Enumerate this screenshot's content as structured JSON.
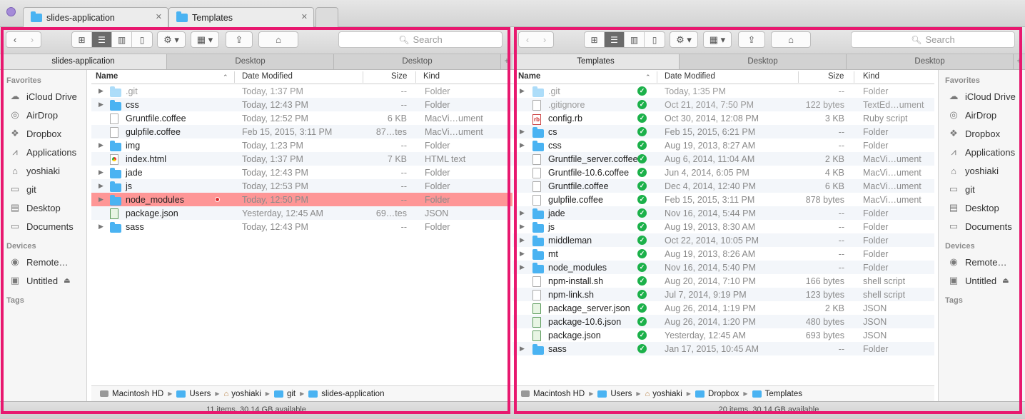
{
  "window_tabs": [
    {
      "label": "slides-application"
    },
    {
      "label": "Templates"
    }
  ],
  "left": {
    "search_placeholder": "Search",
    "pane_tabs": [
      "slides-application",
      "Desktop",
      "Desktop"
    ],
    "sidebar": {
      "favorites_header": "Favorites",
      "favorites": [
        "iCloud Drive",
        "AirDrop",
        "Dropbox",
        "Applications",
        "yoshiaki",
        "git",
        "Desktop",
        "Documents"
      ],
      "devices_header": "Devices",
      "devices": [
        "Remote…",
        "Untitled"
      ],
      "tags_header": "Tags"
    },
    "columns": {
      "name": "Name",
      "date": "Date Modified",
      "size": "Size",
      "kind": "Kind"
    },
    "rows": [
      {
        "name": ".git",
        "date": "Today, 1:37 PM",
        "size": "--",
        "kind": "Folder"
      },
      {
        "name": "css",
        "date": "Today, 12:43 PM",
        "size": "--",
        "kind": "Folder"
      },
      {
        "name": "Gruntfile.coffee",
        "date": "Today, 12:52 PM",
        "size": "6 KB",
        "kind": "MacVi…ument"
      },
      {
        "name": "gulpfile.coffee",
        "date": "Feb 15, 2015, 3:11 PM",
        "size": "87…tes",
        "kind": "MacVi…ument"
      },
      {
        "name": "img",
        "date": "Today, 1:23 PM",
        "size": "--",
        "kind": "Folder"
      },
      {
        "name": "index.html",
        "date": "Today, 1:37 PM",
        "size": "7 KB",
        "kind": "HTML text"
      },
      {
        "name": "jade",
        "date": "Today, 12:43 PM",
        "size": "--",
        "kind": "Folder"
      },
      {
        "name": "js",
        "date": "Today, 12:53 PM",
        "size": "--",
        "kind": "Folder"
      },
      {
        "name": "node_modules",
        "date": "Today, 12:50 PM",
        "size": "--",
        "kind": "Folder"
      },
      {
        "name": "package.json",
        "date": "Yesterday, 12:45 AM",
        "size": "69…tes",
        "kind": "JSON"
      },
      {
        "name": "sass",
        "date": "Today, 12:43 PM",
        "size": "--",
        "kind": "Folder"
      }
    ],
    "path": [
      "Macintosh HD",
      "Users",
      "yoshiaki",
      "git",
      "slides-application"
    ],
    "status": "11 items, 30.14 GB available"
  },
  "right": {
    "search_placeholder": "Search",
    "pane_tabs": [
      "Templates",
      "Desktop",
      "Desktop"
    ],
    "sidebar": {
      "favorites_header": "Favorites",
      "favorites": [
        "iCloud Drive",
        "AirDrop",
        "Dropbox",
        "Applications",
        "yoshiaki",
        "git",
        "Desktop",
        "Documents"
      ],
      "devices_header": "Devices",
      "devices": [
        "Remote…",
        "Untitled"
      ],
      "tags_header": "Tags"
    },
    "columns": {
      "name": "Name",
      "date": "Date Modified",
      "size": "Size",
      "kind": "Kind"
    },
    "rows": [
      {
        "name": ".git",
        "date": "Today, 1:35 PM",
        "size": "--",
        "kind": "Folder"
      },
      {
        "name": ".gitignore",
        "date": "Oct 21, 2014, 7:50 PM",
        "size": "122 bytes",
        "kind": "TextEd…ument"
      },
      {
        "name": "config.rb",
        "date": "Oct 30, 2014, 12:08 PM",
        "size": "3 KB",
        "kind": "Ruby script"
      },
      {
        "name": "cs",
        "date": "Feb 15, 2015, 6:21 PM",
        "size": "--",
        "kind": "Folder"
      },
      {
        "name": "css",
        "date": "Aug 19, 2013, 8:27 AM",
        "size": "--",
        "kind": "Folder"
      },
      {
        "name": "Gruntfile_server.coffee",
        "date": "Aug 6, 2014, 11:04 AM",
        "size": "2 KB",
        "kind": "MacVi…ument"
      },
      {
        "name": "Gruntfile-10.6.coffee",
        "date": "Jun 4, 2014, 6:05 PM",
        "size": "4 KB",
        "kind": "MacVi…ument"
      },
      {
        "name": "Gruntfile.coffee",
        "date": "Dec 4, 2014, 12:40 PM",
        "size": "6 KB",
        "kind": "MacVi…ument"
      },
      {
        "name": "gulpfile.coffee",
        "date": "Feb 15, 2015, 3:11 PM",
        "size": "878 bytes",
        "kind": "MacVi…ument"
      },
      {
        "name": "jade",
        "date": "Nov 16, 2014, 5:44 PM",
        "size": "--",
        "kind": "Folder"
      },
      {
        "name": "js",
        "date": "Aug 19, 2013, 8:30 AM",
        "size": "--",
        "kind": "Folder"
      },
      {
        "name": "middleman",
        "date": "Oct 22, 2014, 10:05 PM",
        "size": "--",
        "kind": "Folder"
      },
      {
        "name": "mt",
        "date": "Aug 19, 2013, 8:26 AM",
        "size": "--",
        "kind": "Folder"
      },
      {
        "name": "node_modules",
        "date": "Nov 16, 2014, 5:40 PM",
        "size": "--",
        "kind": "Folder"
      },
      {
        "name": "npm-install.sh",
        "date": "Aug 20, 2014, 7:10 PM",
        "size": "166 bytes",
        "kind": "shell script"
      },
      {
        "name": "npm-link.sh",
        "date": "Jul 7, 2014, 9:19 PM",
        "size": "123 bytes",
        "kind": "shell script"
      },
      {
        "name": "package_server.json",
        "date": "Aug 26, 2014, 1:19 PM",
        "size": "2 KB",
        "kind": "JSON"
      },
      {
        "name": "package-10.6.json",
        "date": "Aug 26, 2014, 1:20 PM",
        "size": "480 bytes",
        "kind": "JSON"
      },
      {
        "name": "package.json",
        "date": "Yesterday, 12:45 AM",
        "size": "693 bytes",
        "kind": "JSON"
      },
      {
        "name": "sass",
        "date": "Jan 17, 2015, 10:45 AM",
        "size": "--",
        "kind": "Folder"
      }
    ],
    "path": [
      "Macintosh HD",
      "Users",
      "yoshiaki",
      "Dropbox",
      "Templates"
    ],
    "status": "20 items, 30.14 GB available"
  },
  "colors": {
    "highlight_frame": "#e8186f",
    "selected_row": "#fe9696",
    "folder": "#4ab3f2",
    "sync_check": "#1cb14a"
  }
}
